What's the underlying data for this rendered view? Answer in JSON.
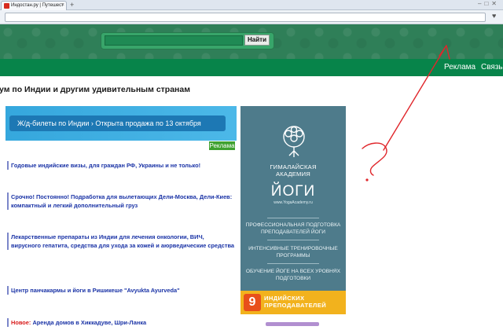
{
  "browser": {
    "tab_title": "Индостан.ру | Путешест",
    "tab_close": "×",
    "new_tab": "+",
    "window_controls": "–□✕"
  },
  "header": {
    "search_placeholder": "",
    "search_button": "Найти",
    "nav": [
      "Реклама",
      "Связь"
    ]
  },
  "page": {
    "subtitle": "ум по Индии и другим удивительным странам"
  },
  "banner": {
    "label": "Ж/д-билеты по Индии  ›  Открыта продажа по 13 октября",
    "ad_badge": "Реклама"
  },
  "news": [
    {
      "prefix": "",
      "text": "Годовые индийские визы, для граждан РФ, Украины и не только!"
    },
    {
      "prefix": "",
      "text": "Срочно! Постоянно! Подработка для вылетающих Дели-Москва, Дели-Киев: компактный и легкий дополнительный груз"
    },
    {
      "prefix": "",
      "text": "Лекарственные препараты из Индии для лечения онкологии, ВИЧ, вирусного гепатита, средства для ухода за кожей и аюрведические средства"
    },
    {
      "prefix": "",
      "text": "Центр панчакармы и йоги в Ришикеше \"Avyukta Ayurveda\""
    },
    {
      "prefix": "Новое: ",
      "text": "Аренда домов в Хиккадуве, Шри-Ланка"
    }
  ],
  "yoga_ad": {
    "line1": "ГИМАЛАЙСКАЯ",
    "line2": "АКАДЕМИЯ",
    "line3": "ЙОГИ",
    "site": "www.YogaAcademy.ru",
    "block1": "ПРОФЕССИОНАЛЬНАЯ ПОДГОТОВКА ПРЕПОДАВАТЕЛЕЙ ЙОГИ",
    "block2": "ИНТЕНСИВНЫЕ ТРЕНИРОВОЧНЫЕ ПРОГРАММЫ",
    "block3": "ОБУЧЕНИЕ ЙОГЕ НА ВСЕХ УРОВНЯХ ПОДГОТОВКИ",
    "number": "9",
    "bottom": "ИНДИЙСКИХ ПРЕПОДАВАТЕЛЕЙ"
  },
  "annotation": {
    "mark": "?",
    "color": "#e0262b"
  }
}
